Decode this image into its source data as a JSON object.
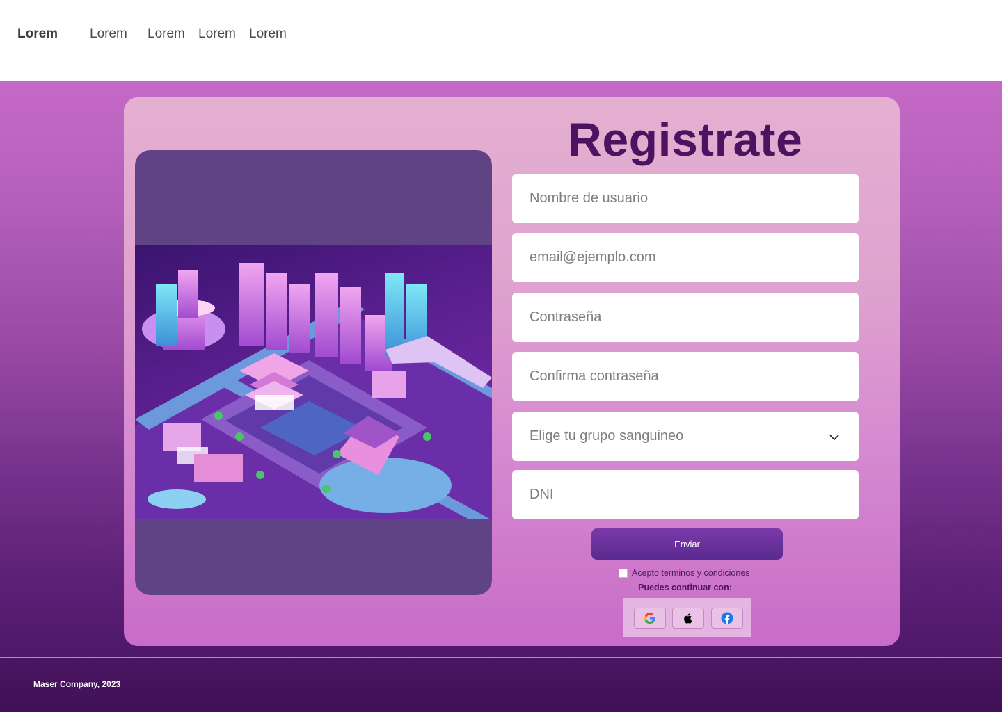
{
  "nav": {
    "brand": "Lorem",
    "links": [
      "Lorem",
      "Lorem",
      "Lorem",
      "Lorem"
    ]
  },
  "form": {
    "title": "Registrate",
    "username_placeholder": "Nombre de usuario",
    "email_placeholder": "email@ejemplo.com",
    "password_placeholder": "Contraseña",
    "confirm_placeholder": "Confirma contraseña",
    "blood_group_select": "Elige tu grupo sanguineo",
    "dni_placeholder": "DNI",
    "submit_label": "Enviar",
    "terms_label": "Acepto terminos y condiciones",
    "continue_label": "Puedes continuar con:"
  },
  "social": [
    "google-icon",
    "apple-icon",
    "facebook-icon"
  ],
  "footer": {
    "text": "Maser Company, 2023"
  },
  "colors": {
    "accent": "#4c1460",
    "button": "#6a32a0",
    "image_panel": "#604384"
  }
}
